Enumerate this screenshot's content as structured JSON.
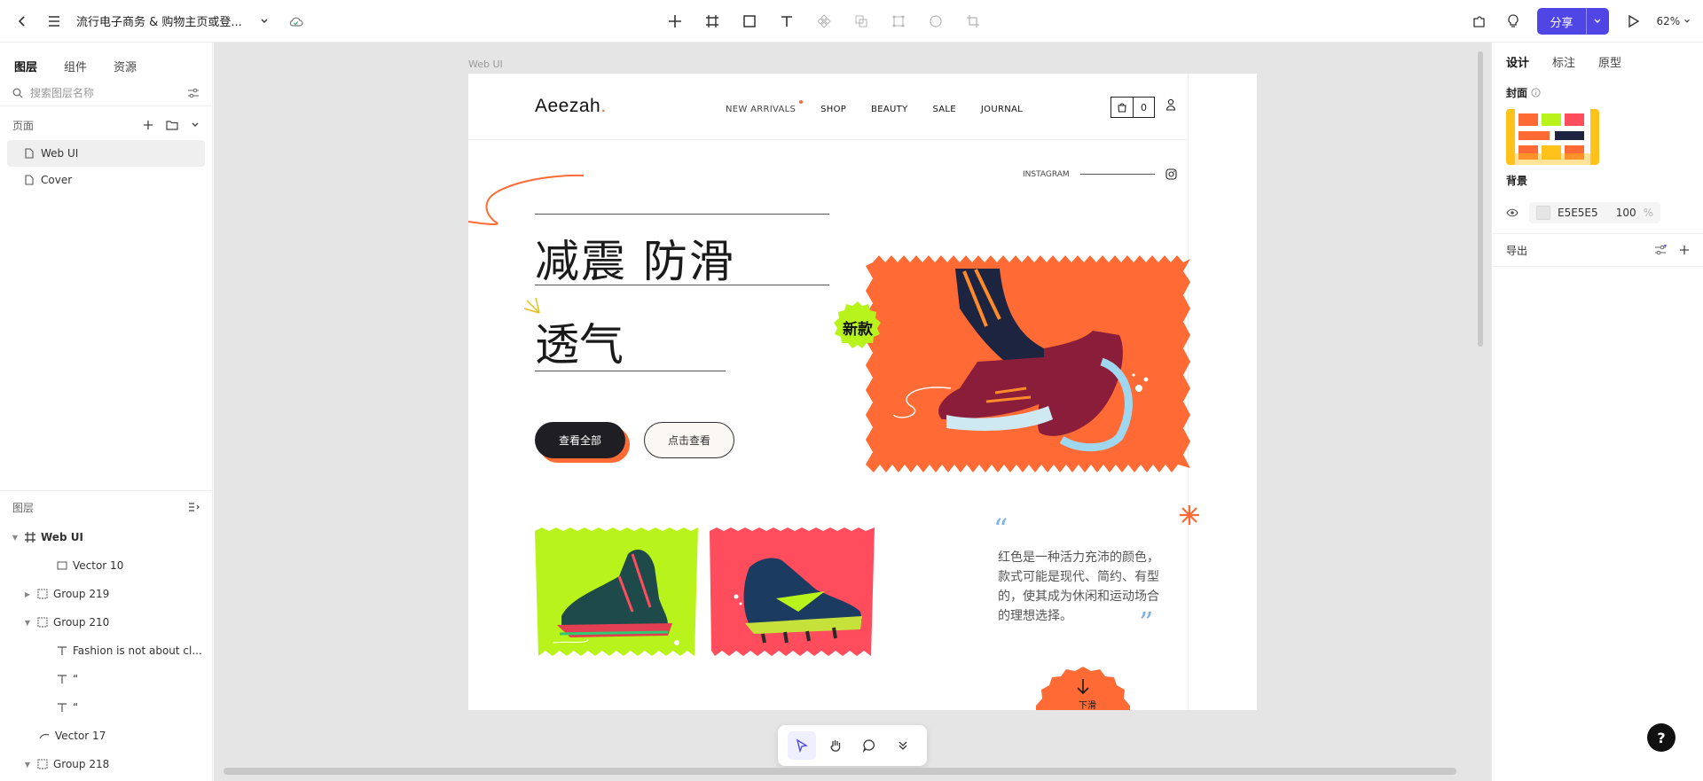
{
  "app": {
    "doc_title": "流行电子商务 & 购物主页或登...",
    "zoom": "62%",
    "share_label": "分享"
  },
  "left_panel": {
    "tabs": [
      "图层",
      "组件",
      "资源"
    ],
    "search_placeholder": "搜索图层名称",
    "pages_header": "页面",
    "pages": [
      "Web UI",
      "Cover"
    ],
    "layers_header": "图层",
    "layers": [
      {
        "name": "Web UI",
        "icon": "frame-icon"
      },
      {
        "name": "Vector 10",
        "icon": "rect-icon"
      },
      {
        "name": "Group 219",
        "icon": "group-icon"
      },
      {
        "name": "Group 210",
        "icon": "group-icon"
      },
      {
        "name": "Fashion is not about cl...",
        "icon": "text-icon"
      },
      {
        "name": "“",
        "icon": "text-icon"
      },
      {
        "name": "“",
        "icon": "text-icon"
      },
      {
        "name": "Vector 17",
        "icon": "vector-icon"
      },
      {
        "name": "Group 218",
        "icon": "group-icon"
      }
    ]
  },
  "canvas": {
    "frame_label": "Web UI",
    "site": {
      "brand": "Aeezah",
      "brand_dot": ".",
      "nav": [
        "NEW ARRIVALS",
        "SHOP",
        "BEAUTY",
        "SALE",
        "JOURNAL"
      ],
      "cart_count": "0",
      "instagram": "INSTAGRAM",
      "headline_1": "减震 防滑",
      "headline_2": "透气",
      "btn_primary": "查看全部",
      "btn_secondary": "点击查看",
      "badge_new": "新款",
      "quote_text": "红色是一种活力充沛的颜色，款式可能是现代、简约、有型的，使其成为休闲和运动场合的理想选择。",
      "quote_open": "“",
      "quote_close": "”",
      "scroll_label": "下滑"
    }
  },
  "right_panel": {
    "tabs": [
      "设计",
      "标注",
      "原型"
    ],
    "cover_label": "封面",
    "background_label": "背景",
    "bg_hex": "E5E5E5",
    "bg_opacity": "100",
    "bg_opacity_unit": "%",
    "export_label": "导出"
  },
  "colors": {
    "accent": "#4f46e5",
    "orange": "#ff6a35",
    "lime": "#b8f41c",
    "pink": "#ff4d5e",
    "canvas_bg": "#e5e5e5"
  }
}
